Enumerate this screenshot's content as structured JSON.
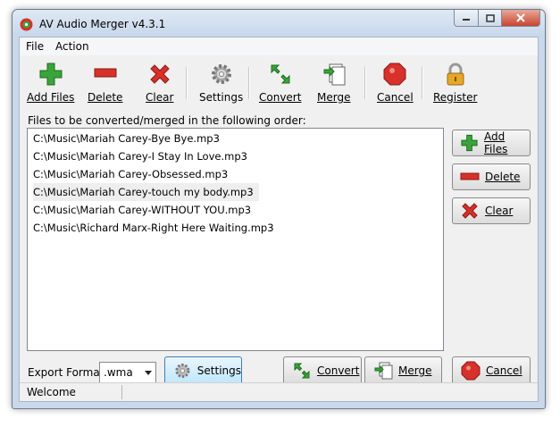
{
  "window": {
    "title": "AV Audio Merger v4.3.1"
  },
  "menu": [
    "File",
    "Action"
  ],
  "toolbar": [
    {
      "label": "Add Files",
      "icon": "plus-icon"
    },
    {
      "label": "Delete",
      "icon": "minus-icon"
    },
    {
      "label": "Clear",
      "icon": "x-icon"
    },
    {
      "label": "Settings",
      "icon": "gear-icon"
    },
    {
      "label": "Convert",
      "icon": "convert-arrows-icon"
    },
    {
      "label": "Merge",
      "icon": "merge-icon"
    },
    {
      "label": "Cancel",
      "icon": "stop-icon"
    },
    {
      "label": "Register",
      "icon": "lock-icon"
    }
  ],
  "files_caption": "Files to be converted/merged in the following order:",
  "files": [
    "C:\\Music\\Mariah Carey-Bye Bye.mp3",
    "C:\\Music\\Mariah Carey-I Stay In Love.mp3",
    "C:\\Music\\Mariah Carey-Obsessed.mp3",
    "C:\\Music\\Mariah Carey-touch my body.mp3",
    "C:\\Music\\Mariah Carey-WITHOUT YOU.mp3",
    "C:\\Music\\Richard Marx-Right Here Waiting.mp3"
  ],
  "side_buttons": {
    "add": "Add Files",
    "delete": "Delete",
    "clear": "Clear"
  },
  "bottom": {
    "export_label": "Export Format:",
    "format_value": ".wma",
    "settings": "Settings",
    "convert": "Convert",
    "merge": "Merge",
    "cancel": "Cancel"
  },
  "status": "Welcome",
  "colors": {
    "green": "#3aa33a",
    "red": "#d8302a",
    "accent": "#3c7fb1"
  }
}
